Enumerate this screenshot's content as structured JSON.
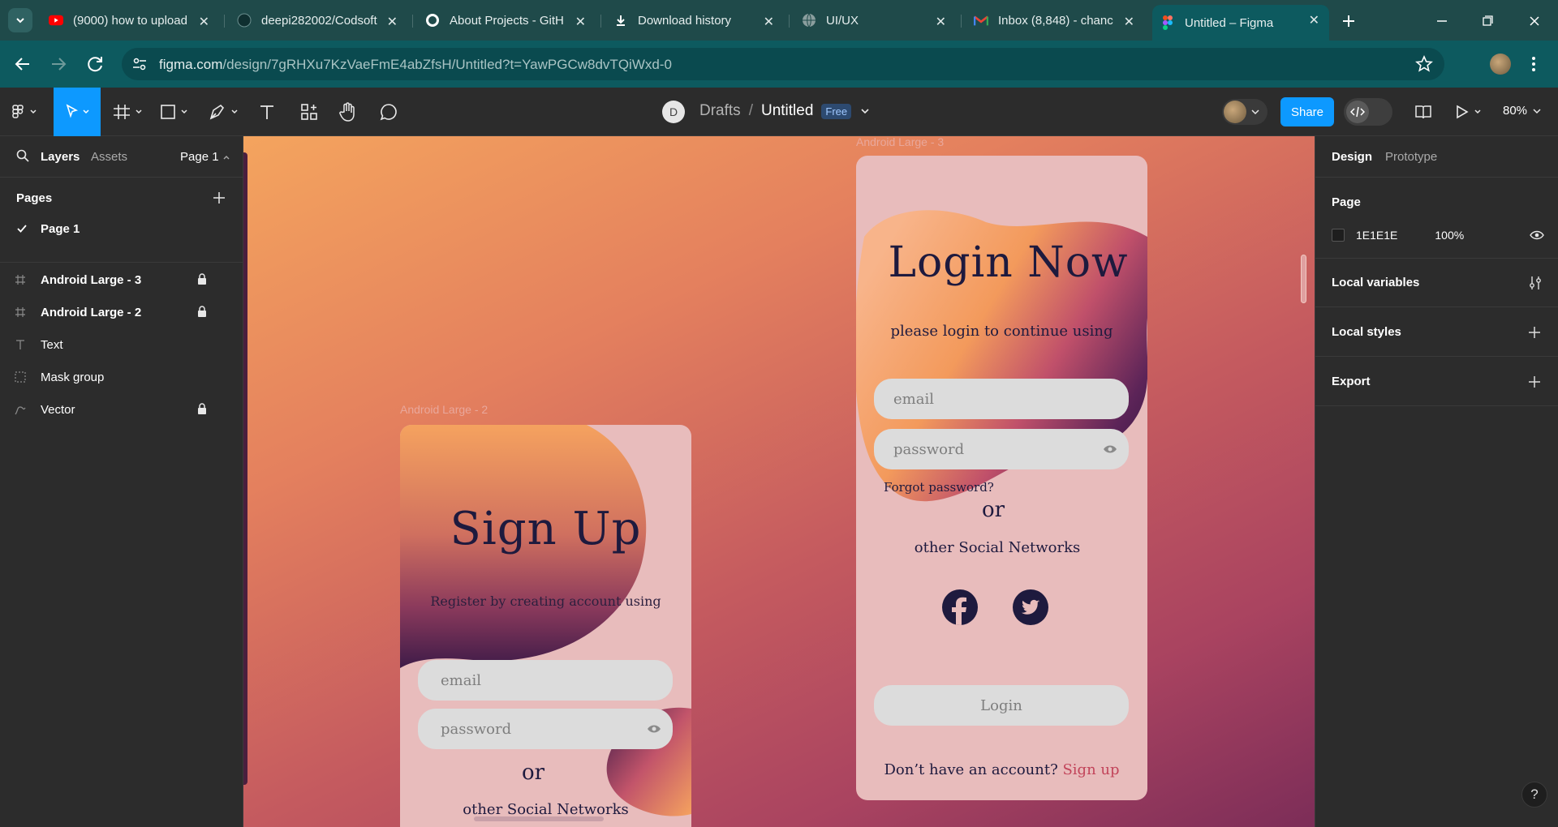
{
  "browser": {
    "tabs": [
      {
        "title": "(9000) how to upload",
        "icon": "youtube-icon"
      },
      {
        "title": "deepi282002/Codsoft",
        "icon": "github-icon"
      },
      {
        "title": "About Projects - GitH",
        "icon": "github-icon"
      },
      {
        "title": "Download history",
        "icon": "download-icon"
      },
      {
        "title": "UI/UX",
        "icon": "globe-icon"
      },
      {
        "title": "Inbox (8,848) - chanc",
        "icon": "gmail-icon"
      },
      {
        "title": "Untitled – Figma",
        "icon": "figma-icon"
      }
    ],
    "url_host": "figma.com",
    "url_path": "/design/7gRHXu7KzVaeFmE4abZfsH/Untitled?t=YawPGCw8dvTQiWxd-0"
  },
  "toolbar": {
    "workspace_initial": "D",
    "breadcrumb_parent": "Drafts",
    "breadcrumb_sep": "/",
    "file_name": "Untitled",
    "plan_badge": "Free",
    "share_label": "Share",
    "zoom": "80%"
  },
  "left_panel": {
    "tab_layers": "Layers",
    "tab_assets": "Assets",
    "page_selector": "Page 1",
    "pages_heading": "Pages",
    "pages": [
      {
        "label": "Page 1"
      }
    ],
    "layers": [
      {
        "label": "Android Large - 3",
        "icon": "frame-icon",
        "locked": true
      },
      {
        "label": "Android Large - 2",
        "icon": "frame-icon",
        "locked": true
      },
      {
        "label": "Text",
        "icon": "text-icon",
        "locked": false
      },
      {
        "label": "Mask group",
        "icon": "mask-icon",
        "locked": false
      },
      {
        "label": "Vector",
        "icon": "vector-icon",
        "locked": true
      }
    ]
  },
  "canvas": {
    "frame_signup": {
      "label": "Android Large - 2",
      "title": "Sign Up",
      "subtitle": "Register by creating account using",
      "email_placeholder": "email",
      "password_placeholder": "password",
      "or_text": "or",
      "social_text": "other Social Networks"
    },
    "frame_login": {
      "label": "Android Large - 3",
      "title": "Login Now",
      "subtitle": "please login to continue using",
      "email_placeholder": "email",
      "password_placeholder": "password",
      "forgot": "Forgot password?",
      "or_text": "or",
      "social_text": "other Social Networks",
      "login_button": "Login",
      "no_account": "Don’t have an account?",
      "signup_link": "Sign up"
    }
  },
  "right_panel": {
    "tab_design": "Design",
    "tab_prototype": "Prototype",
    "page_heading": "Page",
    "page_color": "1E1E1E",
    "page_opacity": "100%",
    "local_variables": "Local variables",
    "local_styles": "Local styles",
    "export": "Export"
  },
  "colors": {
    "share_blue": "#0d99ff",
    "accent_link": "#c2445a",
    "ink": "#1e1a3e"
  }
}
